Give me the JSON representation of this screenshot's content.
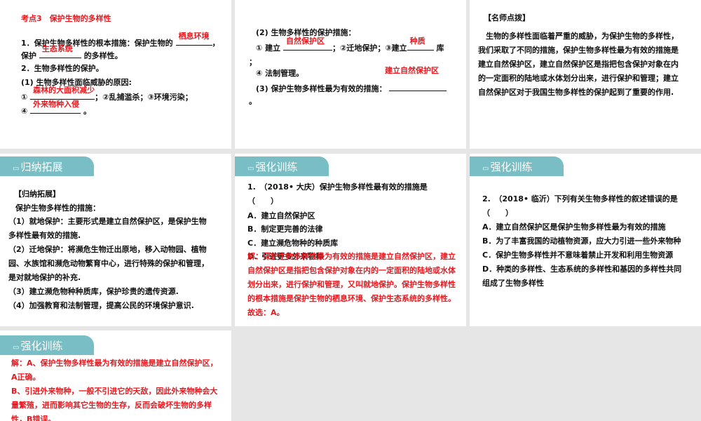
{
  "slides": [
    {
      "title": "考点3　保护生物的多样性",
      "l1a": "1．保护生物多样性的根本措施：保护生物的",
      "l1b": "，",
      "ans1": "栖息环境",
      "l2a": "保护",
      "ans2": "生态系统",
      "l2b": "的多样性。",
      "l3": "2．生物多样性的保护。",
      "l4": "(1) 生物多样性面临威胁的原因:",
      "l5a": "①",
      "ans3": "森林的大面积减少",
      "l5b": "；②乱捕滥杀；③环境污染；",
      "l6a": "④",
      "ans4": "外来物种入侵",
      "l6b": "。"
    },
    {
      "l1": "(2) 生物多样性的保护措施：",
      "l2a": "① 建立",
      "ans1": "自然保护区",
      "l2b": "；②迁地保护；③建立",
      "ans2": "种质",
      "l2c": "库",
      "l3": "；",
      "l4": "④ 法制管理。",
      "ans3": "建立自然保护区",
      "l5": "(3) 保护生物多样性最为有效的措施：",
      "l6": "。"
    },
    {
      "heading": "【名师点拨】",
      "body": "　生物的多样性面临着严重的威胁，为保护生物的多样性，我们采取了不同的措施，保护生物多样性最为有效的措施是建立自然保护区，建立自然保护区是指把包含保护对象在内的一定面积的陆地或水体划分出来，进行保护和管理；建立自然保护区对于我国生物多样性的保护起到了重要的作用."
    },
    {
      "tab": "归纳拓展",
      "heading": "【归纳拓展】",
      "intro": "保护生物多样性的措施：",
      "items": [
        "（1）就地保护：主要形式是建立自然保护区，是保护生物多样性最有效的措施.",
        "（2）迁地保护：将濒危生物迁出原地，移入动物园、植物园、水族馆和濒危动物繁育中心，进行特殊的保护和管理，是对就地保护的补充.",
        "（3）建立濒危物种种质库，保护珍贵的遗传资源.",
        "（4）加强教育和法制管理，提高公民的环境保护意识."
      ]
    },
    {
      "tab": "强化训练",
      "question": "1.　（2018• 大庆）保护生物多样性最有效的措施是（　　）",
      "options": [
        "A．建立自然保护区",
        "B．制定更完善的法律",
        "C．建立濒危物种的种质库",
        "D．引进更多外来物种"
      ],
      "answer": "解：保护生物多样性最为有效的措施是建立自然保护区，建立自然保护区是指把包含保护对象在内的一定面积的陆地或水体划分出来，进行保护和管理，又叫就地保护。保护生物多样性的根本措施是保护生物的栖息环境、保护生态系统的多样性。",
      "choice": "故选：A。"
    },
    {
      "tab": "强化训练",
      "question": "2.　（2018• 临沂）下列有关生物多样性的叙述错误的是（　　）",
      "options": [
        "A．建立自然保护区是保护生物多样性最为有效的措施",
        "B．为了丰富我国的动植物资源，应大力引进一些外来物种",
        "C．保护生物多样性并不意味着禁止开发和利用生物资源",
        "D．种类的多样性、生态系统的多样性和基因的多样性共同组成了生物多样性"
      ]
    },
    {
      "tab": "强化训练",
      "answer": "解：A、保护生物多样性最为有效的措施是建立自然保护区，A正确。\nB、引进外来物种，一般不引进它的天敌，因此外来物种会大量繁殖，进而影响其它生物的生存，反而会破坏生物的多样性，B错误。"
    }
  ]
}
